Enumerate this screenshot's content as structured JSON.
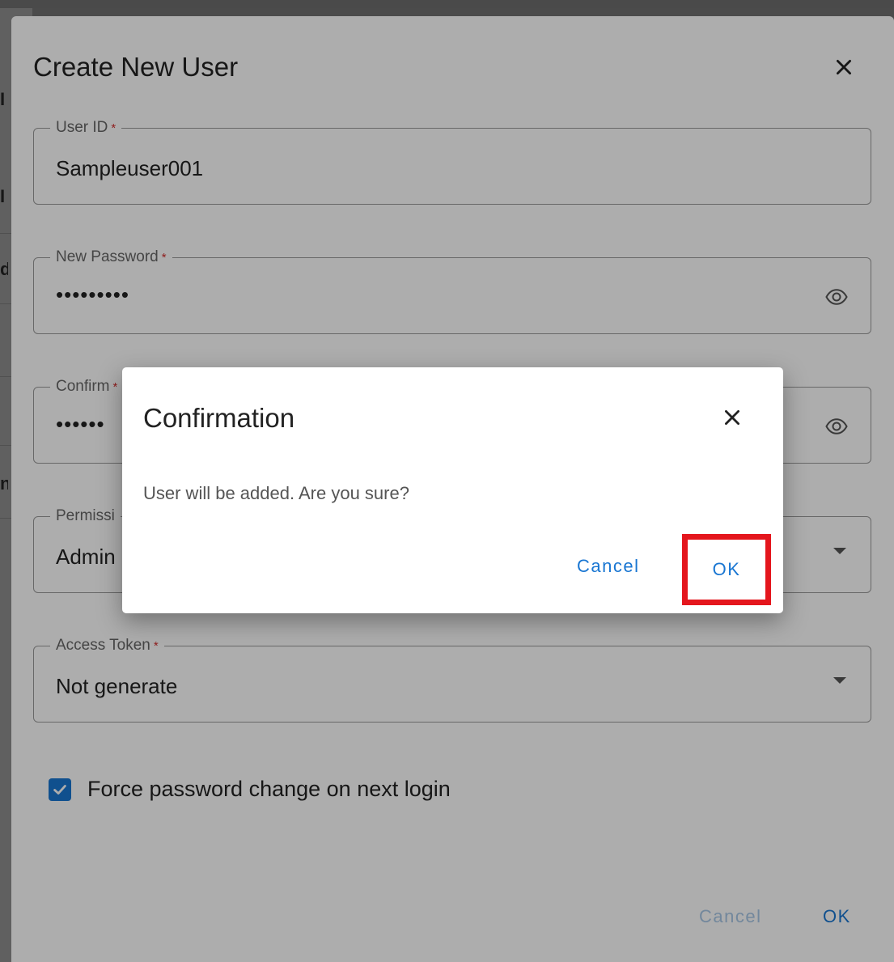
{
  "background": {
    "fragments": [
      "I",
      "I",
      "d",
      "n"
    ]
  },
  "create_dialog": {
    "title": "Create New User",
    "close_icon": "close-icon",
    "fields": {
      "user_id": {
        "label": "User ID",
        "required_mark": "*",
        "value": "Sampleuser001"
      },
      "new_password": {
        "label": "New Password",
        "required_mark": "*",
        "value": "•••••••••",
        "icon": "eye-icon"
      },
      "confirm_password": {
        "label": "Confirm",
        "required_mark": "*",
        "value": "••••••",
        "icon": "eye-icon"
      },
      "permission": {
        "label": "Permissi",
        "value": "Admin",
        "icon": "dropdown-caret-icon"
      },
      "access_token": {
        "label": "Access Token",
        "required_mark": "*",
        "value": "Not generate",
        "icon": "dropdown-caret-icon"
      }
    },
    "force_password_change": {
      "label": "Force password change on next login",
      "checked": true
    },
    "footer": {
      "cancel_label": "Cancel",
      "ok_label": "OK"
    }
  },
  "confirmation_dialog": {
    "title": "Confirmation",
    "message": "User will be added. Are you sure?",
    "cancel_label": "Cancel",
    "ok_label": "OK",
    "highlight_color": "#e4161d"
  },
  "colors": {
    "accent": "#1976d2",
    "required": "#d32f2f"
  }
}
